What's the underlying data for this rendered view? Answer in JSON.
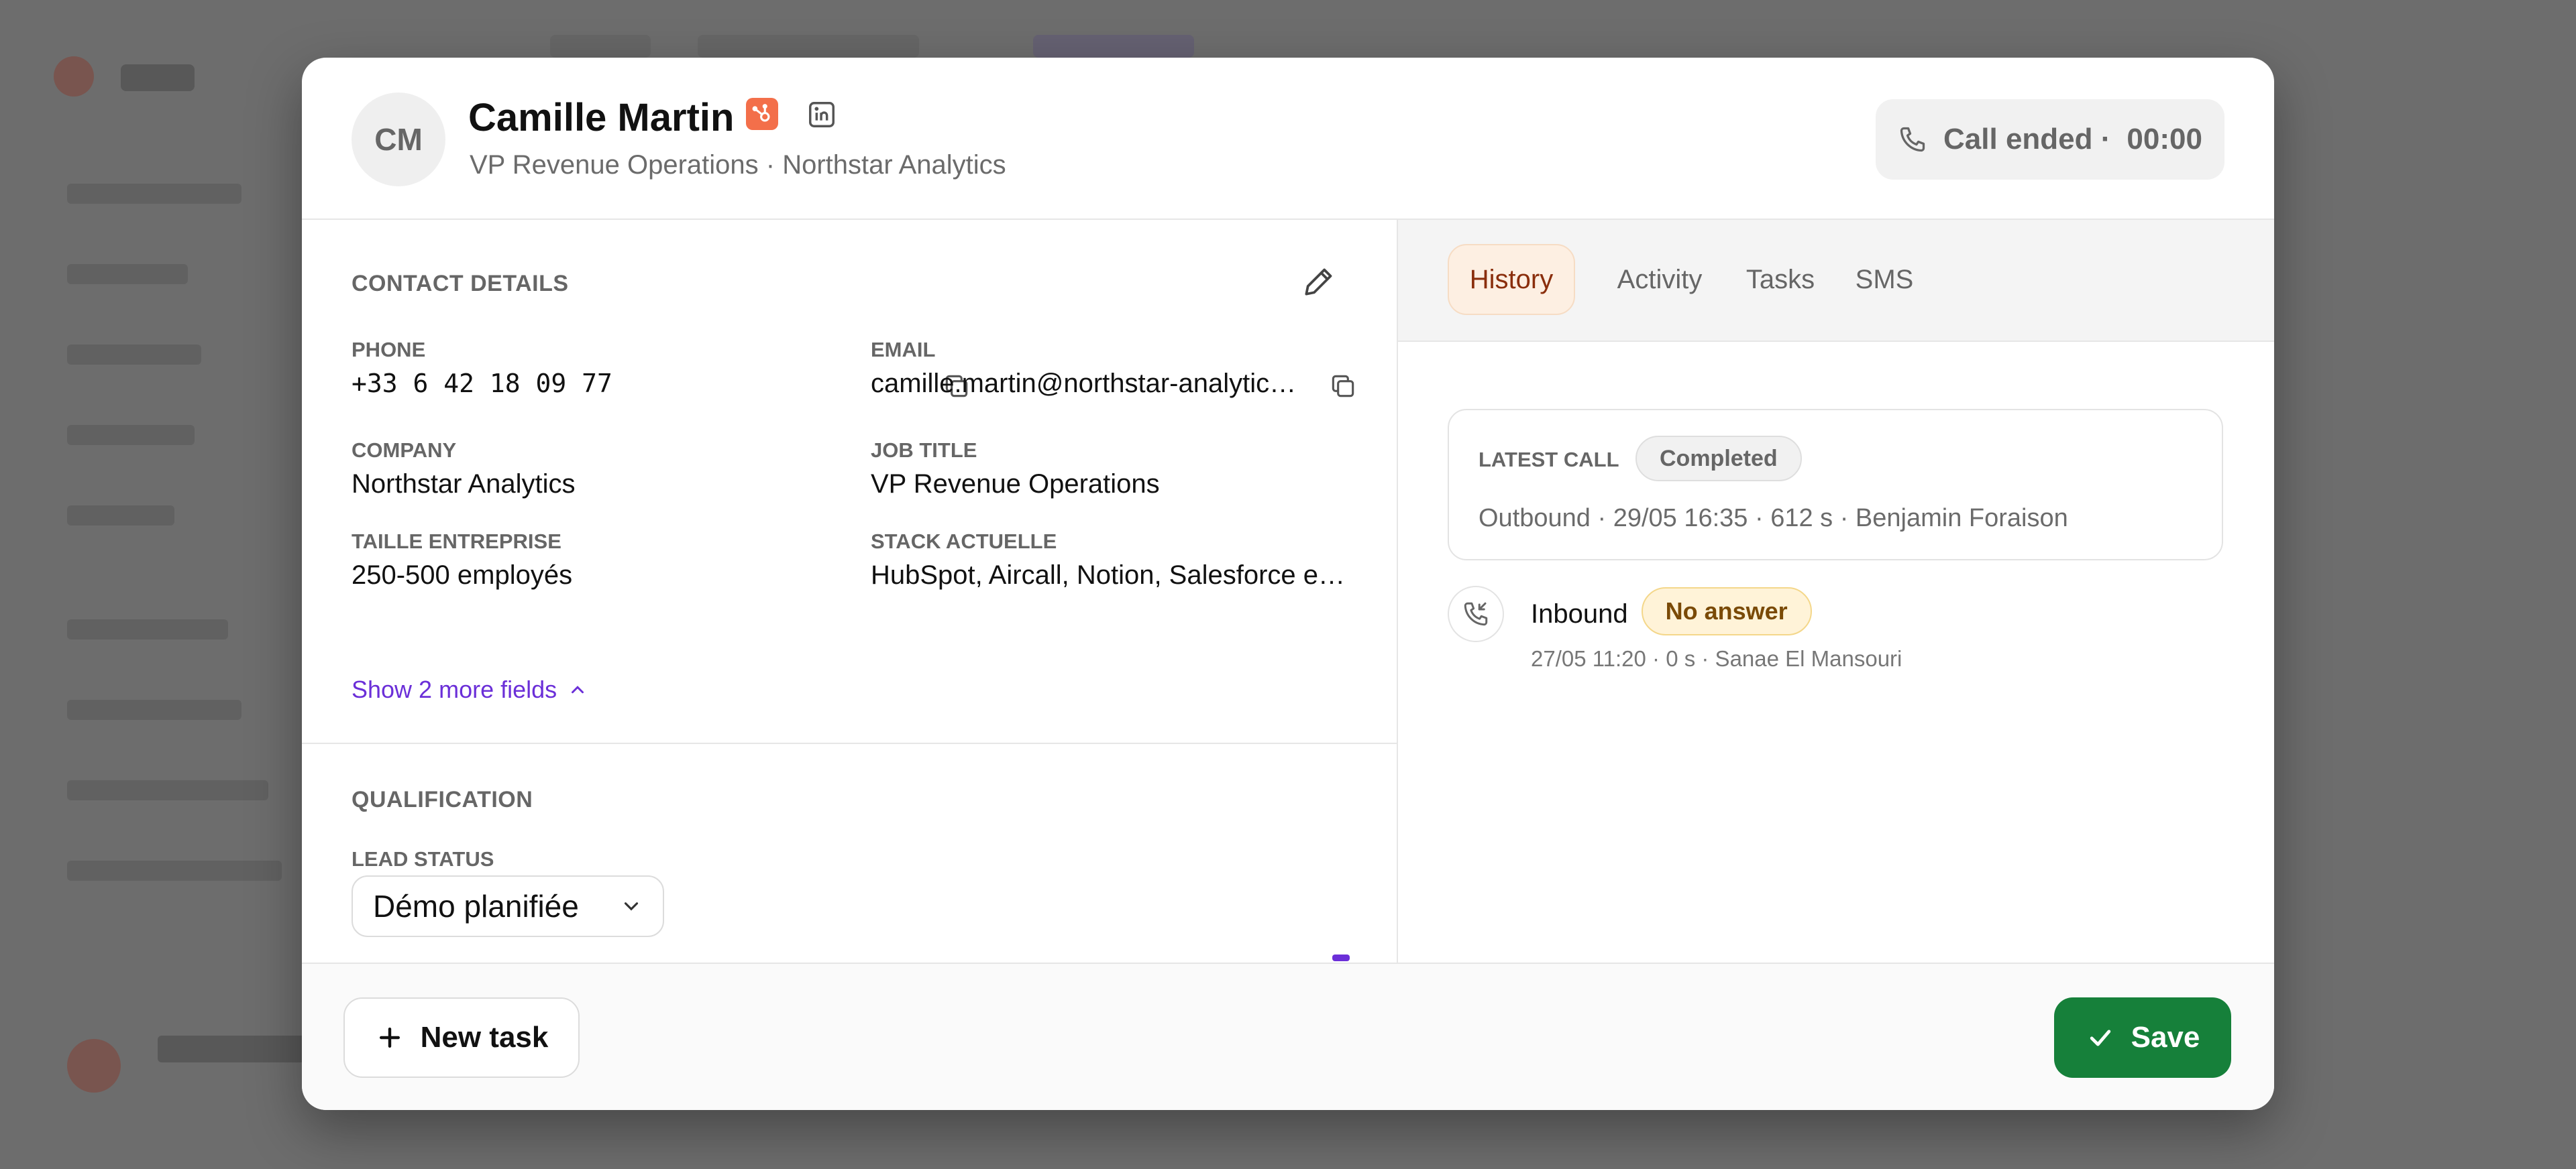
{
  "colors": {
    "accent_link": "#6b2fd8",
    "save_green": "#16803a",
    "hubspot_orange": "#f36f4a",
    "active_tab_bg": "#fdefe2",
    "active_tab_text": "#8a2e0c",
    "no_answer_bg": "#fff3d8"
  },
  "contact": {
    "initials": "CM",
    "name": "Camille Martin",
    "subtitle": "VP Revenue Operations · Northstar Analytics",
    "icons": [
      "hubspot-icon",
      "linkedin-icon"
    ]
  },
  "call_status": {
    "label": "Call ended ·",
    "timer": "00:00",
    "icon": "phone-icon"
  },
  "details": {
    "section_title": "CONTACT DETAILS",
    "fields": [
      {
        "label": "PHONE",
        "value": "+33 6 42 18 09 77"
      },
      {
        "label": "EMAIL",
        "value": "camille.martin@northstar-analytics.com"
      },
      {
        "label": "COMPANY",
        "value": "Northstar Analytics"
      },
      {
        "label": "JOB TITLE",
        "value": "VP Revenue Operations"
      },
      {
        "label": "TAILLE ENTREPRISE",
        "value": "250-500 employés"
      },
      {
        "label": "STACK ACTUELLE",
        "value": "HubSpot, Aircall, Notion, Salesforce e…"
      }
    ],
    "more_fields": "Show 2 more fields"
  },
  "qualification": {
    "section_title": "QUALIFICATION",
    "lead_status_label": "LEAD STATUS",
    "lead_status_value": "Démo planifiée"
  },
  "tabs": [
    {
      "label": "History",
      "active": true
    },
    {
      "label": "Activity",
      "active": false
    },
    {
      "label": "Tasks",
      "active": false
    },
    {
      "label": "SMS",
      "active": false
    }
  ],
  "history": {
    "latest_label": "LATEST CALL",
    "latest_status": "Completed",
    "latest_meta": "Outbound · 29/05 16:35 · 612 s · Benjamin Foraison",
    "items": [
      {
        "direction": "Inbound",
        "status": "No answer",
        "meta": "27/05 11:20 · 0 s · Sanae El Mansouri"
      }
    ]
  },
  "footer": {
    "new_task": "New task",
    "save": "Save"
  }
}
